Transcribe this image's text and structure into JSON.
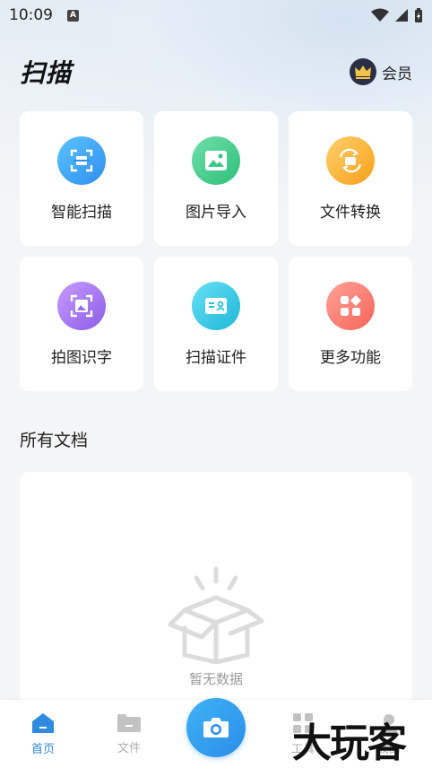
{
  "status_bar": {
    "time": "10:09",
    "notification_badge": "A"
  },
  "header": {
    "title": "扫描",
    "vip_label": "会员"
  },
  "features": [
    {
      "label": "智能扫描",
      "icon": "scan-frame-icon",
      "color_from": "#5bc3ff",
      "color_to": "#2f8ff0"
    },
    {
      "label": "图片导入",
      "icon": "image-icon",
      "color_from": "#6fe0a8",
      "color_to": "#2fbf7a"
    },
    {
      "label": "文件转换",
      "icon": "file-convert-icon",
      "color_from": "#ffd06b",
      "color_to": "#f9a01b"
    },
    {
      "label": "拍图识字",
      "icon": "photo-text-icon",
      "color_from": "#c59bff",
      "color_to": "#8d5ce8"
    },
    {
      "label": "扫描证件",
      "icon": "id-card-icon",
      "color_from": "#67e0f5",
      "color_to": "#1fb7d8"
    },
    {
      "label": "更多功能",
      "icon": "more-grid-icon",
      "color_from": "#ffa296",
      "color_to": "#f5645a"
    }
  ],
  "documents": {
    "section_title": "所有文档",
    "empty_text": "暂无数据"
  },
  "tabbar": {
    "tabs": [
      {
        "label": "首页",
        "icon": "home-icon",
        "active": true
      },
      {
        "label": "文件",
        "icon": "folder-icon",
        "active": false
      },
      {
        "label": "工具",
        "icon": "tools-icon",
        "active": false
      },
      {
        "label": "我的",
        "icon": "profile-icon",
        "active": false
      }
    ],
    "camera_icon": "camera-icon"
  },
  "watermark": "大玩客",
  "colors": {
    "accent": "#2f8ae0",
    "vip_badge": "#2b2f45",
    "vip_crown": "#f4c24a"
  }
}
